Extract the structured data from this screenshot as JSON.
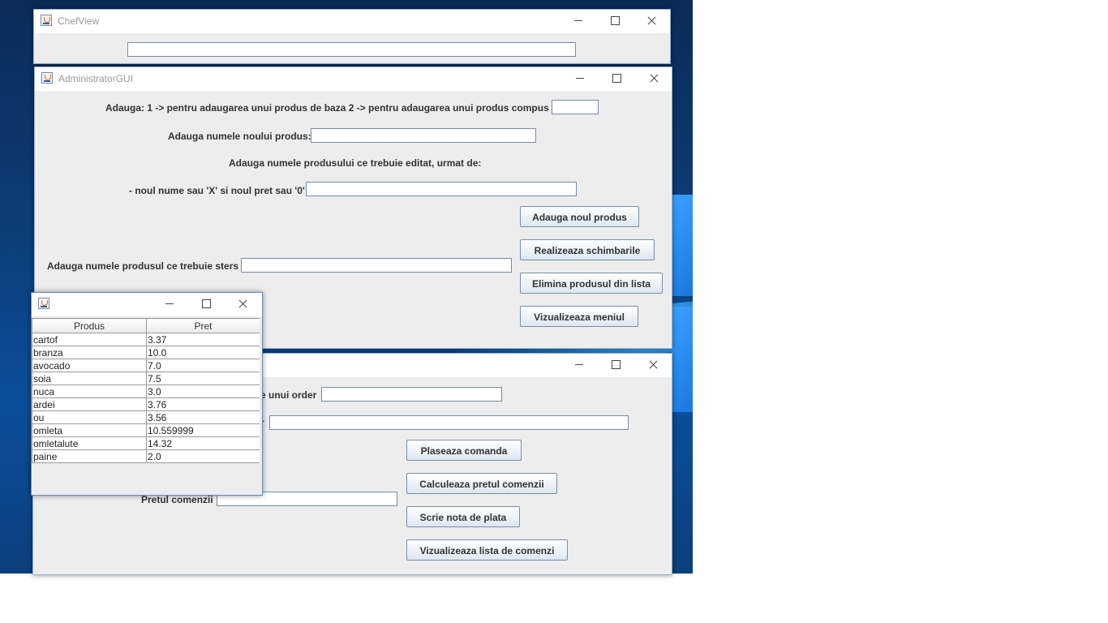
{
  "chefview": {
    "title": "ChefView",
    "field_value": ""
  },
  "admin": {
    "title": "AdministratorGUI",
    "add_type_label": "Adauga: 1 -> pentru adaugarea unui produs de baza  2 ->  pentru adaugarea unui produs compus",
    "add_type_value": "",
    "new_name_label": "Adauga numele noului produs:",
    "new_name_value": "",
    "edit_label_1": "Adauga numele produsului ce trebuie editat, urmat de:",
    "edit_label_2": "- noul nume sau 'X' si noul pret sau '0'",
    "edit_value": "",
    "delete_label": "Adauga numele produsul ce trebuie sters",
    "delete_value": "",
    "btn_add": "Adauga noul produs",
    "btn_edit": "Realizeaza schimbarile",
    "btn_delete": "Elimina produsul din lista",
    "btn_view_menu": "Vizualizeaza meniul"
  },
  "waiter": {
    "order_label_partial": "e unui order",
    "order_value": "",
    "order2_label_partial": "r",
    "order2_value": "",
    "price_label": "Pretul comenzii",
    "price_value": "",
    "btn_place": "Plaseaza comanda",
    "btn_compute": "Calculeaza pretul comenzii",
    "btn_bill": "Scrie nota de plata",
    "btn_view_orders": "Vizualizeaza lista de comenzi"
  },
  "menu_table": {
    "columns": [
      "Produs",
      "Pret"
    ],
    "rows": [
      [
        "cartof",
        "3.37"
      ],
      [
        "branza",
        "10.0"
      ],
      [
        "avocado",
        "7.0"
      ],
      [
        "soia",
        "7.5"
      ],
      [
        "nuca",
        "3.0"
      ],
      [
        "ardei",
        "3.76"
      ],
      [
        "ou",
        "3.56"
      ],
      [
        "omleta",
        "10.559999"
      ],
      [
        "omletalute",
        "14.32"
      ],
      [
        "paine",
        "2.0"
      ]
    ]
  },
  "icons": [
    "java-app-icon",
    "minimize-icon",
    "maximize-icon",
    "close-icon"
  ],
  "colors": {
    "desktop": "#0d3d78",
    "window_bg": "#ededed",
    "titlebar": "#ffffff",
    "button_top": "#ffffff",
    "button_bottom": "#dde6f1"
  }
}
